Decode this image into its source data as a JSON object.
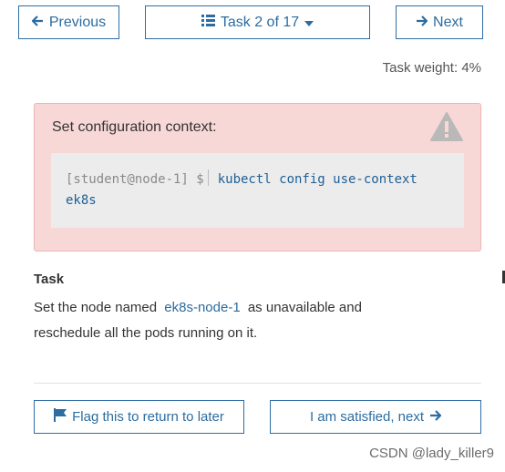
{
  "nav": {
    "previous_label": "Previous",
    "previous_icon": "arrow-left-icon",
    "task_label": "Task 2 of 17",
    "task_icon": "list-icon",
    "task_caret_icon": "caret-down-icon",
    "next_label": "Next",
    "next_icon": "arrow-right-icon"
  },
  "task_weight": "Task weight: 4%",
  "alert": {
    "title": "Set configuration context:",
    "icon": "warning-icon",
    "prompt": "[student@node-1] $",
    "command_line1": "kubectl config use-context",
    "command_line2": "ek8s"
  },
  "task": {
    "heading": "Task",
    "text_before": "Set the node named",
    "node_name": "ek8s-node-1",
    "text_after_line1": "as unavailable and",
    "text_line2": "reschedule all the pods running on it."
  },
  "actions": {
    "flag_label": "Flag this to return to later",
    "flag_icon": "flag-icon",
    "satisfied_label": "I am satisfied, next",
    "satisfied_icon": "arrow-right-icon"
  },
  "watermark": "CSDN @lady_killer9",
  "colors": {
    "accent": "#2c6ca0",
    "alert_bg": "#f8d7d7",
    "code_bg": "#ececec"
  }
}
